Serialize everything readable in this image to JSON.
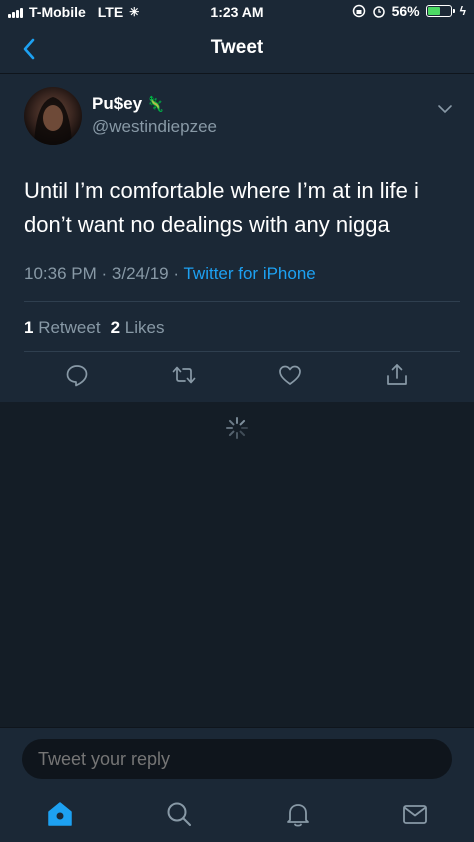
{
  "status_bar": {
    "carrier": "T-Mobile",
    "network": "LTE",
    "time": "1:23 AM",
    "battery": "56%",
    "battery_level": 0.56
  },
  "header": {
    "title": "Tweet",
    "back_icon": "chevron-left-icon"
  },
  "tweet": {
    "user_name": "Pu$ey",
    "user_emoji": "🦎",
    "handle": "@westindiepzee",
    "text": "Until I’m comfortable where I’m at in life i don’t want no dealings with any nigga",
    "time": "10:36 PM",
    "date": "3/24/19",
    "separator": "·",
    "source": "Twitter for iPhone",
    "retweet_count": "1",
    "retweet_label": "Retweet",
    "like_count": "2",
    "like_label": "Likes"
  },
  "reply": {
    "placeholder": "Tweet your reply"
  },
  "colors": {
    "background": "#141d26",
    "card": "#1b2836",
    "accent": "#1da1f2",
    "secondary_text": "#8899a6"
  },
  "tabs": [
    "home-icon",
    "search-icon",
    "notifications-icon",
    "messages-icon"
  ]
}
